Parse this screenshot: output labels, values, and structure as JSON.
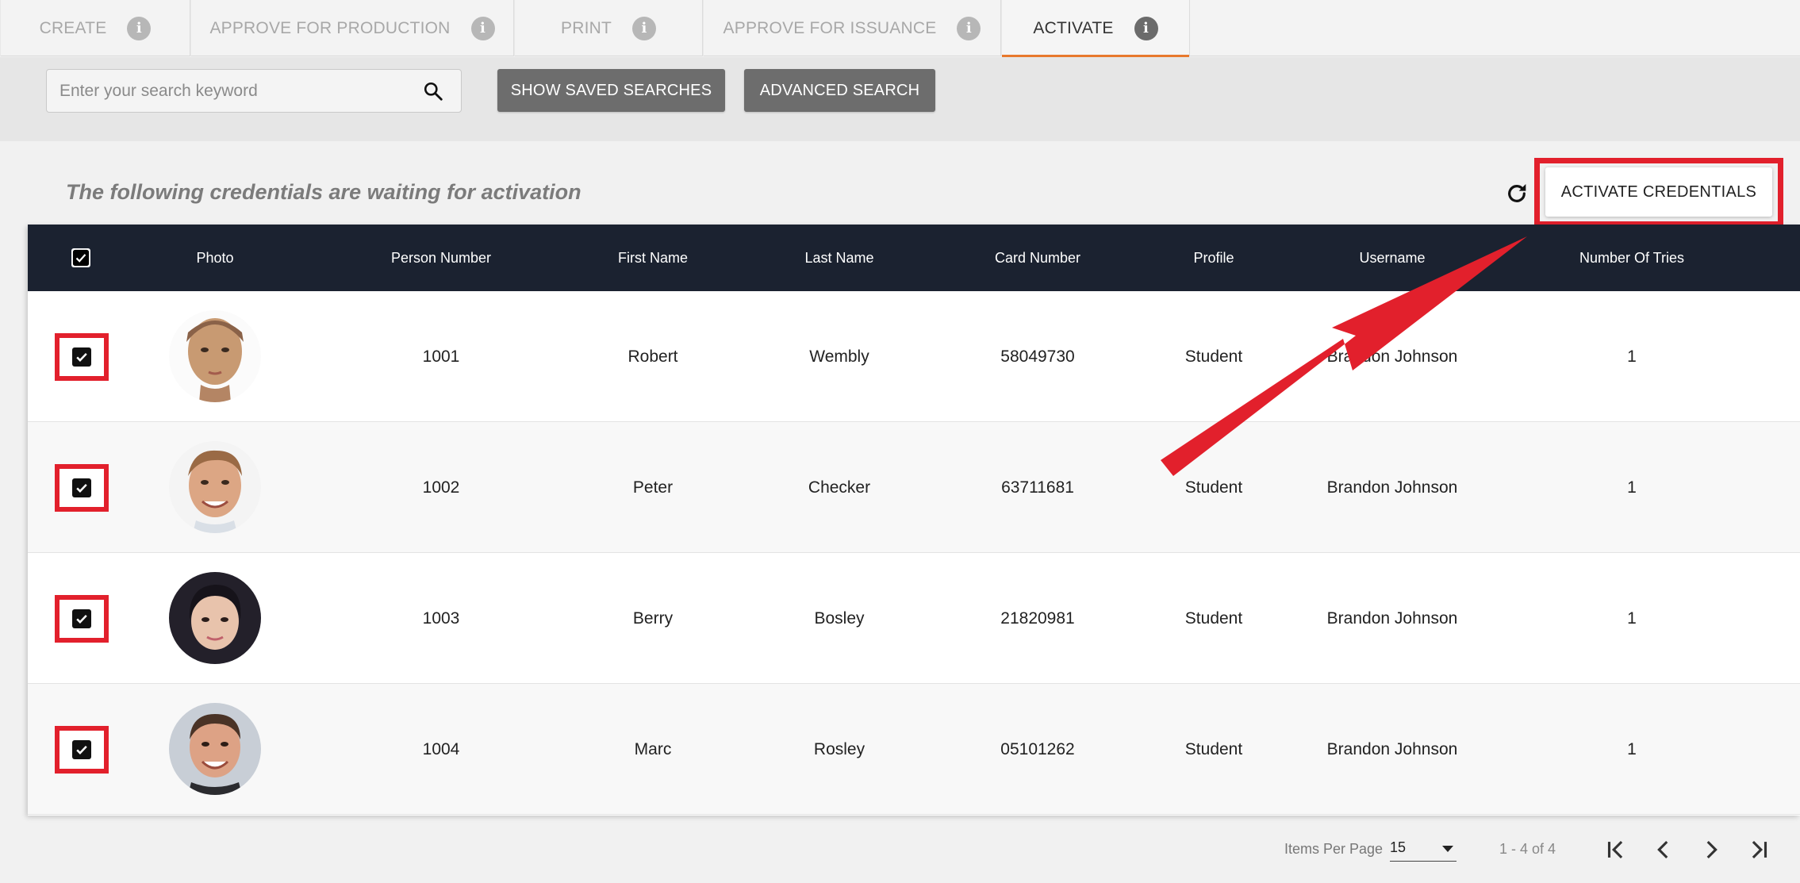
{
  "tabs": [
    {
      "label": "CREATE"
    },
    {
      "label": "APPROVE FOR PRODUCTION"
    },
    {
      "label": "PRINT"
    },
    {
      "label": "APPROVE FOR ISSUANCE"
    },
    {
      "label": "ACTIVATE",
      "active": true
    }
  ],
  "search": {
    "placeholder": "Enter your search keyword",
    "saved_label": "SHOW SAVED SEARCHES",
    "advanced_label": "ADVANCED SEARCH"
  },
  "main": {
    "heading": "The following credentials are waiting for activation",
    "activate_label": "ACTIVATE CREDENTIALS"
  },
  "table": {
    "headers": {
      "photo": "Photo",
      "person_number": "Person Number",
      "first_name": "First Name",
      "last_name": "Last Name",
      "card_number": "Card Number",
      "profile": "Profile",
      "username": "Username",
      "tries": "Number Of Tries"
    },
    "rows": [
      {
        "person_number": "1001",
        "first_name": "Robert",
        "last_name": "Wembly",
        "card_number": "58049730",
        "profile": "Student",
        "username": "Brandon Johnson",
        "tries": "1",
        "checked": true
      },
      {
        "person_number": "1002",
        "first_name": "Peter",
        "last_name": "Checker",
        "card_number": "63711681",
        "profile": "Student",
        "username": "Brandon Johnson",
        "tries": "1",
        "checked": true
      },
      {
        "person_number": "1003",
        "first_name": "Berry",
        "last_name": "Bosley",
        "card_number": "21820981",
        "profile": "Student",
        "username": "Brandon Johnson",
        "tries": "1",
        "checked": true
      },
      {
        "person_number": "1004",
        "first_name": "Marc",
        "last_name": "Rosley",
        "card_number": "05101262",
        "profile": "Student",
        "username": "Brandon Johnson",
        "tries": "1",
        "checked": true
      }
    ]
  },
  "pagination": {
    "items_per_page_label": "Items Per Page",
    "items_per_page": "15",
    "range": "1 - 4 of 4"
  },
  "colors": {
    "accent": "#e8792d",
    "header_bg": "#1b2230",
    "annotation_red": "#e2202c"
  },
  "icons": [
    "info-icon",
    "search-icon",
    "refresh-icon",
    "checkbox-checked-icon",
    "first-page-icon",
    "prev-page-icon",
    "next-page-icon",
    "last-page-icon"
  ]
}
